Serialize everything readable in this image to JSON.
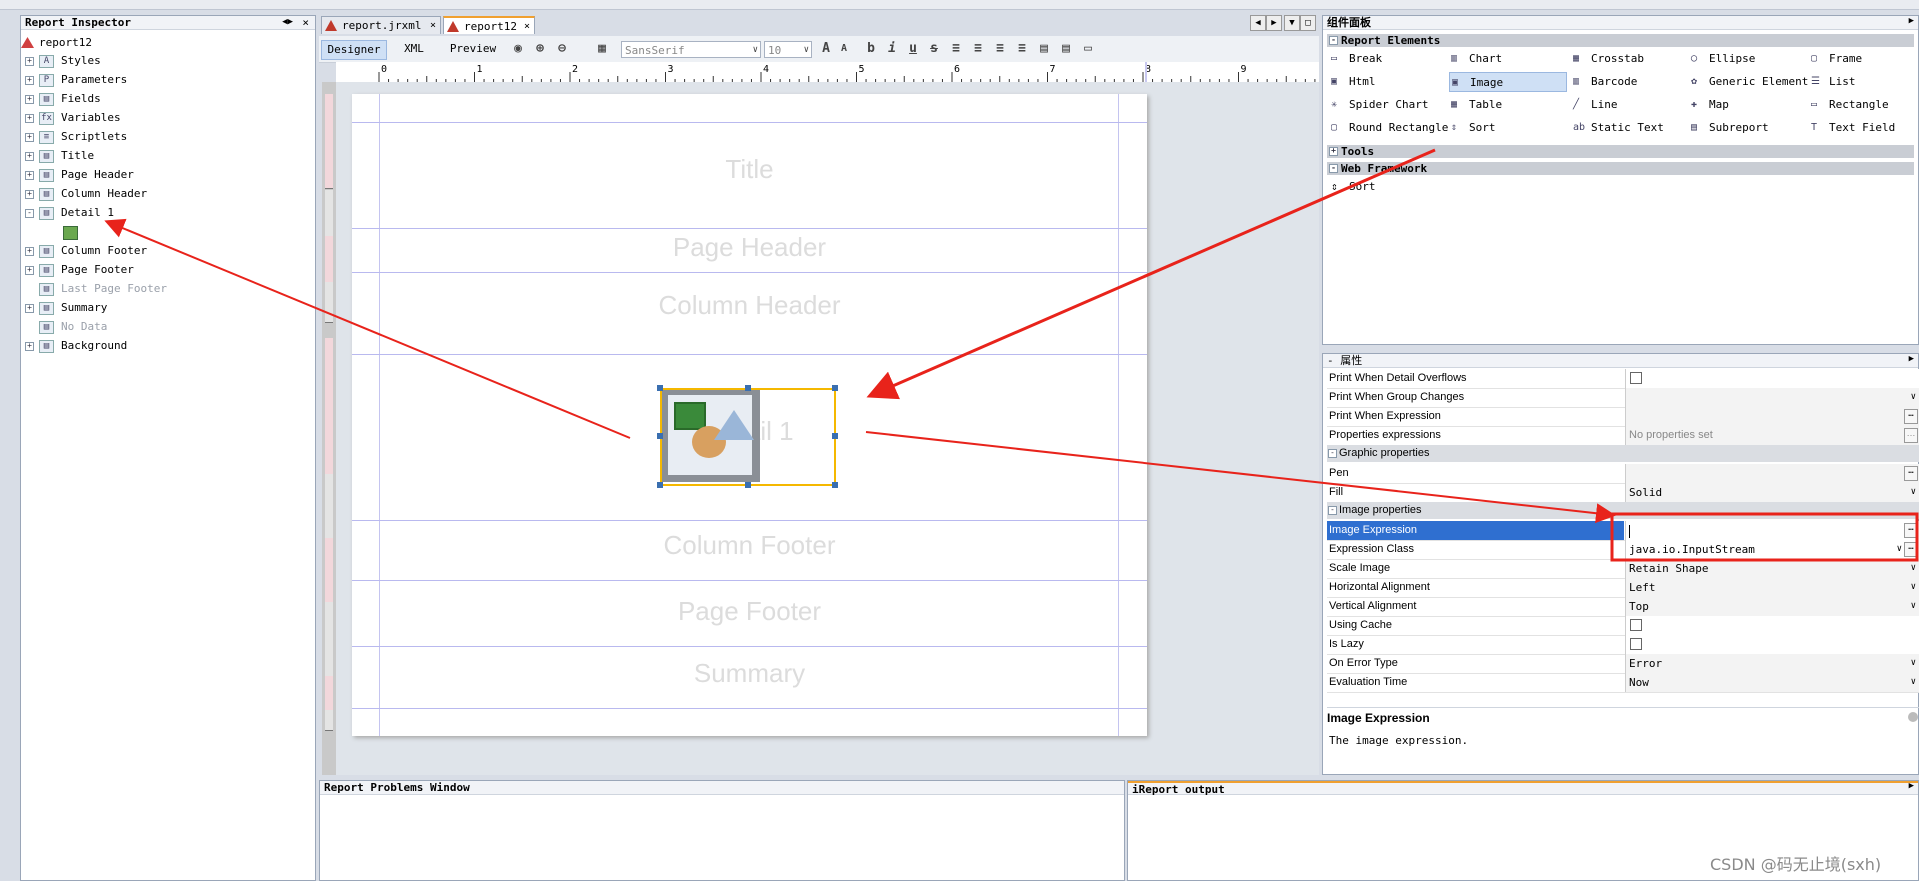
{
  "inspector": {
    "title": "Report Inspector",
    "root": "report12",
    "items": [
      {
        "label": "Styles",
        "expander": "+",
        "icon": "styles-icon",
        "dim": false
      },
      {
        "label": "Parameters",
        "expander": "+",
        "icon": "parameters-icon",
        "dim": false
      },
      {
        "label": "Fields",
        "expander": "+",
        "icon": "fields-icon",
        "dim": false
      },
      {
        "label": "Variables",
        "expander": "+",
        "icon": "variables-icon",
        "dim": false
      },
      {
        "label": "Scriptlets",
        "expander": "+",
        "icon": "scriptlets-icon",
        "dim": false
      },
      {
        "label": "Title",
        "expander": "+",
        "icon": "band-icon",
        "dim": false
      },
      {
        "label": "Page Header",
        "expander": "+",
        "icon": "band-icon",
        "dim": false
      },
      {
        "label": "Column Header",
        "expander": "+",
        "icon": "band-icon",
        "dim": false
      },
      {
        "label": "Detail 1",
        "expander": "-",
        "icon": "band-icon",
        "dim": false
      },
      {
        "label": "",
        "expander": "",
        "icon": "image-element-icon",
        "dim": false
      },
      {
        "label": "Column Footer",
        "expander": "+",
        "icon": "band-icon",
        "dim": false
      },
      {
        "label": "Page Footer",
        "expander": "+",
        "icon": "band-icon",
        "dim": false
      },
      {
        "label": "Last Page Footer",
        "expander": "",
        "icon": "band-icon",
        "dim": true
      },
      {
        "label": "Summary",
        "expander": "+",
        "icon": "band-icon",
        "dim": false
      },
      {
        "label": "No Data",
        "expander": "",
        "icon": "band-icon",
        "dim": true
      },
      {
        "label": "Background",
        "expander": "+",
        "icon": "band-icon",
        "dim": false
      }
    ]
  },
  "tabs": [
    {
      "label": "report.jrxml",
      "active": false
    },
    {
      "label": "report12",
      "active": true
    }
  ],
  "toolbar": {
    "designer": "Designer",
    "xml": "XML",
    "preview": "Preview",
    "font": "SansSerif",
    "size": "10"
  },
  "ruler": {
    "labels": [
      "0",
      "1",
      "2",
      "3",
      "4",
      "5",
      "6",
      "7",
      "8",
      "9"
    ]
  },
  "bands": [
    {
      "label": "Title"
    },
    {
      "label": "Page Header"
    },
    {
      "label": "Column Header"
    },
    {
      "label": "Detail 1"
    },
    {
      "label": "Column Footer"
    },
    {
      "label": "Page Footer"
    },
    {
      "label": "Summary"
    }
  ],
  "palette": {
    "title": "组件面板",
    "report_elements": "Report Elements",
    "items": [
      {
        "label": "Break",
        "icon": "break-icon"
      },
      {
        "label": "Chart",
        "icon": "chart-icon"
      },
      {
        "label": "Crosstab",
        "icon": "crosstab-icon"
      },
      {
        "label": "Ellipse",
        "icon": "ellipse-icon"
      },
      {
        "label": "Frame",
        "icon": "frame-icon"
      },
      {
        "label": "Html",
        "icon": "html-icon"
      },
      {
        "label": "Image",
        "icon": "image-icon",
        "selected": true
      },
      {
        "label": "Barcode",
        "icon": "barcode-icon"
      },
      {
        "label": "Generic Element",
        "icon": "generic-element-icon"
      },
      {
        "label": "List",
        "icon": "list-icon"
      },
      {
        "label": "Spider Chart",
        "icon": "spider-chart-icon"
      },
      {
        "label": "Table",
        "icon": "table-icon"
      },
      {
        "label": "Line",
        "icon": "line-icon"
      },
      {
        "label": "Map",
        "icon": "map-icon"
      },
      {
        "label": "Rectangle",
        "icon": "rectangle-icon"
      },
      {
        "label": "Round Rectangle",
        "icon": "round-rectangle-icon"
      },
      {
        "label": "Sort",
        "icon": "sort-icon"
      },
      {
        "label": "Static Text",
        "icon": "static-text-icon"
      },
      {
        "label": "Subreport",
        "icon": "subreport-icon"
      },
      {
        "label": "Text Field",
        "icon": "text-field-icon"
      }
    ],
    "tools": "Tools",
    "web_framework": "Web Framework",
    "web_items": [
      {
        "label": "Sort",
        "icon": "sort-icon"
      }
    ]
  },
  "properties": {
    "title": "- 属性",
    "rows": [
      {
        "kind": "row",
        "name": "Print When Detail Overflows",
        "type": "check"
      },
      {
        "kind": "row",
        "name": "Print When Group Changes",
        "type": "combo",
        "value": ""
      },
      {
        "kind": "row",
        "name": "Print When Expression",
        "type": "ellipsis",
        "value": ""
      },
      {
        "kind": "row",
        "name": "Properties expressions",
        "type": "ellipsis-dim",
        "value": "No properties set"
      },
      {
        "kind": "section",
        "name": "Graphic properties"
      },
      {
        "kind": "row",
        "name": "Pen",
        "type": "ellipsis",
        "value": ""
      },
      {
        "kind": "row",
        "name": "Fill",
        "type": "combo",
        "value": "Solid"
      },
      {
        "kind": "section",
        "name": "Image properties"
      },
      {
        "kind": "row",
        "name": "Image Expression",
        "type": "ellipsis-edit",
        "value": "",
        "selected": true
      },
      {
        "kind": "row",
        "name": "Expression Class",
        "type": "combo-ellipsis",
        "value": "java.io.InputStream"
      },
      {
        "kind": "row",
        "name": "Scale Image",
        "type": "combo",
        "value": "Retain Shape"
      },
      {
        "kind": "row",
        "name": "Horizontal Alignment",
        "type": "combo",
        "value": "Left"
      },
      {
        "kind": "row",
        "name": "Vertical Alignment",
        "type": "combo",
        "value": "Top"
      },
      {
        "kind": "row",
        "name": "Using Cache",
        "type": "check"
      },
      {
        "kind": "row",
        "name": "Is Lazy",
        "type": "check"
      },
      {
        "kind": "row",
        "name": "On Error Type",
        "type": "combo",
        "value": "Error"
      },
      {
        "kind": "row",
        "name": "Evaluation Time",
        "type": "combo",
        "value": "Now"
      }
    ],
    "help_title": "Image Expression",
    "help_text": "The image expression."
  },
  "bottom": {
    "problems": "Report Problems Window",
    "output": "iReport output"
  },
  "watermark": "CSDN @码无止境(sxh)",
  "colors": {
    "accent": "#f0a030",
    "arrow": "#e8231b",
    "selection": "#2f6fd0"
  }
}
